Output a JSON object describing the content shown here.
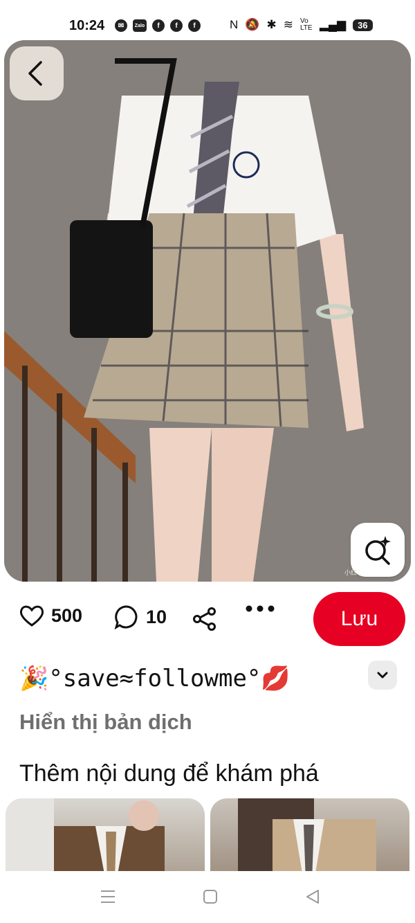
{
  "status_bar": {
    "time": "10:24",
    "notifications": [
      "messenger-icon",
      "zalo-icon",
      "facebook-icon",
      "facebook-icon",
      "facebook-icon"
    ],
    "zalo_label": "Zalo",
    "system_icons": [
      "nfc-icon",
      "mute-icon",
      "bluetooth-icon",
      "wifi-icon",
      "volte-icon",
      "signal-icon"
    ],
    "volte_label": "Vo LTE",
    "battery": "36"
  },
  "pin": {
    "image_icon_names": [
      "back-arrow-icon",
      "visual-search-icon"
    ],
    "watermark": "小红"
  },
  "actions": {
    "like_count": "500",
    "comment_count": "10",
    "save_label": "Lưu",
    "save_color": "#e60023"
  },
  "content": {
    "title": "🎉°save≈followme°💋",
    "translate_label": "Hiển thị bản dịch",
    "more_heading": "Thêm nội dung để khám phá"
  },
  "navbar": {
    "icons": [
      "menu-icon",
      "home-square-icon",
      "back-triangle-icon"
    ]
  }
}
